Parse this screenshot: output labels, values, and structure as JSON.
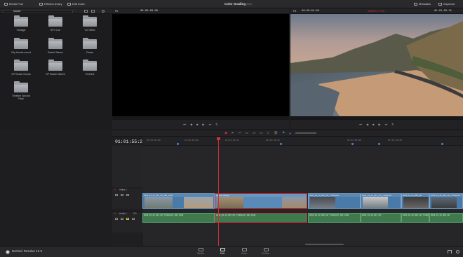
{
  "topbar": {
    "tabs": [
      {
        "label": "Media Pool",
        "icon": "media-pool-icon"
      },
      {
        "label": "Effects Library",
        "icon": "effects-icon"
      },
      {
        "label": "Edit Index",
        "icon": "edit-index-icon"
      }
    ],
    "project_title": "Color Grading",
    "project_status": "Edited",
    "right_tabs": [
      {
        "label": "Metadata",
        "icon": "metadata-icon"
      },
      {
        "label": "Inspector",
        "icon": "inspector-icon"
      }
    ]
  },
  "media_pool": {
    "bin_label": "Master",
    "bins": [
      "Footage",
      "SFX Cue",
      "VO Office",
      "City Aerials sound",
      "Beach Waves",
      "Ocean",
      "GP Beach Ocean",
      "GP Beach Waves",
      "Timeline",
      "Timeline Second Pass"
    ]
  },
  "source_viewer": {
    "zoom": "Fit",
    "timecode": "00:00:00:00"
  },
  "timeline_viewer": {
    "duration": "00:00:04:00",
    "name": "SAMPLE FILE",
    "zoom": "Fit",
    "timecode": "01:01:55:21"
  },
  "timeline": {
    "current_timecode": "01:01:55:21",
    "ruler": [
      "01:01:00:00",
      "01:01:20:00",
      "01:01:40:11",
      "01:01:60:11",
      "01:02:00:00",
      "01:02:20:00"
    ],
    "video_track": {
      "name": "Video 1",
      "id": "V1"
    },
    "audio_track": {
      "name": "Audio 1",
      "id": "A1",
      "level": "2.0"
    },
    "video_clips": [
      "2018_03_20_004_GP_MD_1000",
      "Speed Change",
      "2018_03_20_006_GP_TORQUAY",
      "2018_03_20_007_GP_TORQUAY",
      "2018_03_20_008_GP",
      "2018_03_20_009_GP_TORQUAY"
    ],
    "audio_clips": [
      "2018_03_20_004_GP_TORQUAY_MD_1000",
      "2018_03_20_005_GP_TORQUAY_MD_1000",
      "2018_03_20_006_GP_TORQUAY_MD_1000",
      "2018_03_20_007_GP",
      "2018_03_20_008_GP_TORQUAY",
      "2018_03_20_009_GP"
    ]
  },
  "bottom": {
    "app_name": "DaVinci Resolve 12.5",
    "pages": [
      "Media",
      "Edit",
      "Color",
      "Deliver"
    ],
    "active_page": "Edit"
  },
  "colors": {
    "accent_red": "#c8303a",
    "video_clip": "#4a7aa8",
    "audio_clip": "#3f7a4e",
    "marker": "#3d8ad8"
  }
}
